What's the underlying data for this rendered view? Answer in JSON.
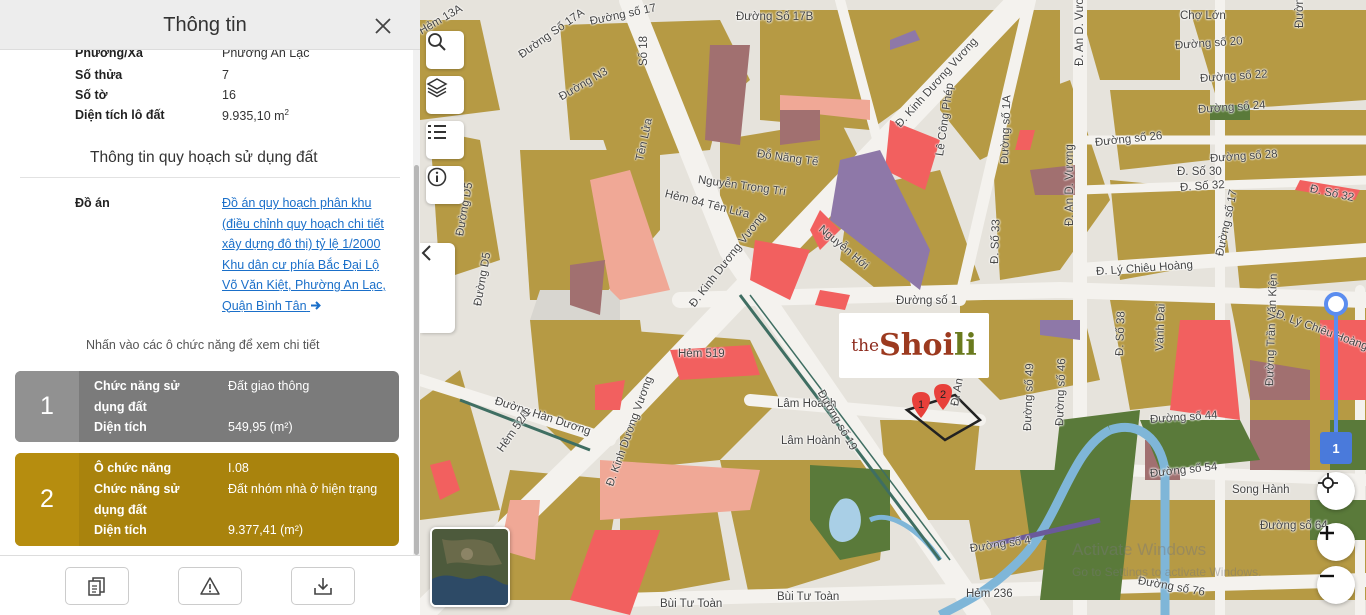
{
  "panel": {
    "title": "Thông tin",
    "parcel": [
      {
        "label": "Phường/Xã",
        "value": "Phường An Lạc"
      },
      {
        "label": "Số thửa",
        "value": "7"
      },
      {
        "label": "Số tờ",
        "value": "16"
      },
      {
        "label": "Diện tích lô đất",
        "value": "9.935,10 m"
      }
    ],
    "area_unit_sup": "2",
    "section_title": "Thông tin quy hoạch sử dụng đất",
    "doan_label": "Đồ án",
    "doan_link": "Đồ án quy hoạch phân khu (điều chỉnh quy hoạch chi tiết xây dựng đô thị) tỷ lệ 1/2000 Khu dân cư phía Bắc Đại Lộ Võ Văn Kiệt, Phường An Lạc, Quận Bình Tân",
    "hint": "Nhấn vào các ô chức năng để xem chi tiết",
    "cards": [
      {
        "number": "1",
        "rows": [
          {
            "key": "Chức năng sử dụng đất",
            "value": "Đất giao thông"
          },
          {
            "key": "Diện tích",
            "value": "549,95 (m²)"
          }
        ]
      },
      {
        "number": "2",
        "rows": [
          {
            "key": "Ô chức năng",
            "value": "I.08"
          },
          {
            "key": "Chức năng sử dụng đất",
            "value": "Đất nhóm nhà ở hiện trạng"
          },
          {
            "key": "Diện tích",
            "value": "9.377,41 (m²)"
          }
        ]
      }
    ]
  },
  "map": {
    "street_labels": [
      "Đường Số 17A",
      "Đường số 17",
      "Đường Số 17B",
      "Đường N3",
      "Số 18",
      "Tên Lửa",
      "Đường D5",
      "Đường D5",
      "Đ. Kinh Dương Vương",
      "Đ. Kinh Dương Vương",
      "Đ. Kinh Dương Vương",
      "Nguyễn Trọng Trí",
      "Hẻm 84 Tên Lửa",
      "Đỗ Năng Tế",
      "Nguyễn Hới",
      "Lê Công Phép",
      "Đường số 1",
      "Hẻm 519",
      "Đường Hàn Dương",
      "Hẻm 52/1",
      "Lâm Hoành",
      "Lâm Hoành",
      "Đ. An D. Vương",
      "Đ. An D. Vương",
      "Đ. An D. Vương",
      "Đường số 26",
      "Đường số 20",
      "Đường số 22",
      "Đường số 24",
      "Đường số 28",
      "Đ. Số 30",
      "Đ. Số 32",
      "Đ. Số 32",
      "Đường số 17",
      "Đ. Lý Chiêu Hoàng",
      "Đ. Lý Chiêu Hoàng",
      "Vành Đai",
      "Đường số 44",
      "Đường số 54",
      "Song Hành",
      "Đường số 64",
      "Đường số 4",
      "Đường số 76",
      "Hẻm 236",
      "Bùi Tư Toàn",
      "Bùi Tư Toàn",
      "Chợ Lớn",
      "Đường Trần Văn Kiện",
      "Đ. Số 33",
      "Đường số 1A",
      "Đ. Số 38",
      "Đường số 46",
      "Đường số 49",
      "Đường số 19",
      "Đường Số 16",
      "Hẻm 13A"
    ],
    "logo_the": "the",
    "logo_shoi": "Shoi",
    "logo_li": "li",
    "markers": [
      "1",
      "2"
    ],
    "scale_badge": "1",
    "watermark": "Activate Windows",
    "watermark_sub": "Go to Settings to activate Windows."
  },
  "colors": {
    "residential": "#b69a44",
    "road": "#f4f2ee",
    "transport": "#d8d6d0",
    "commercial": "#f2605f",
    "public": "#8e78a8",
    "green": "#5a7a3a",
    "water": "#7fb6d8",
    "accent_red": "#e8403a",
    "link": "#1a6fc9"
  }
}
